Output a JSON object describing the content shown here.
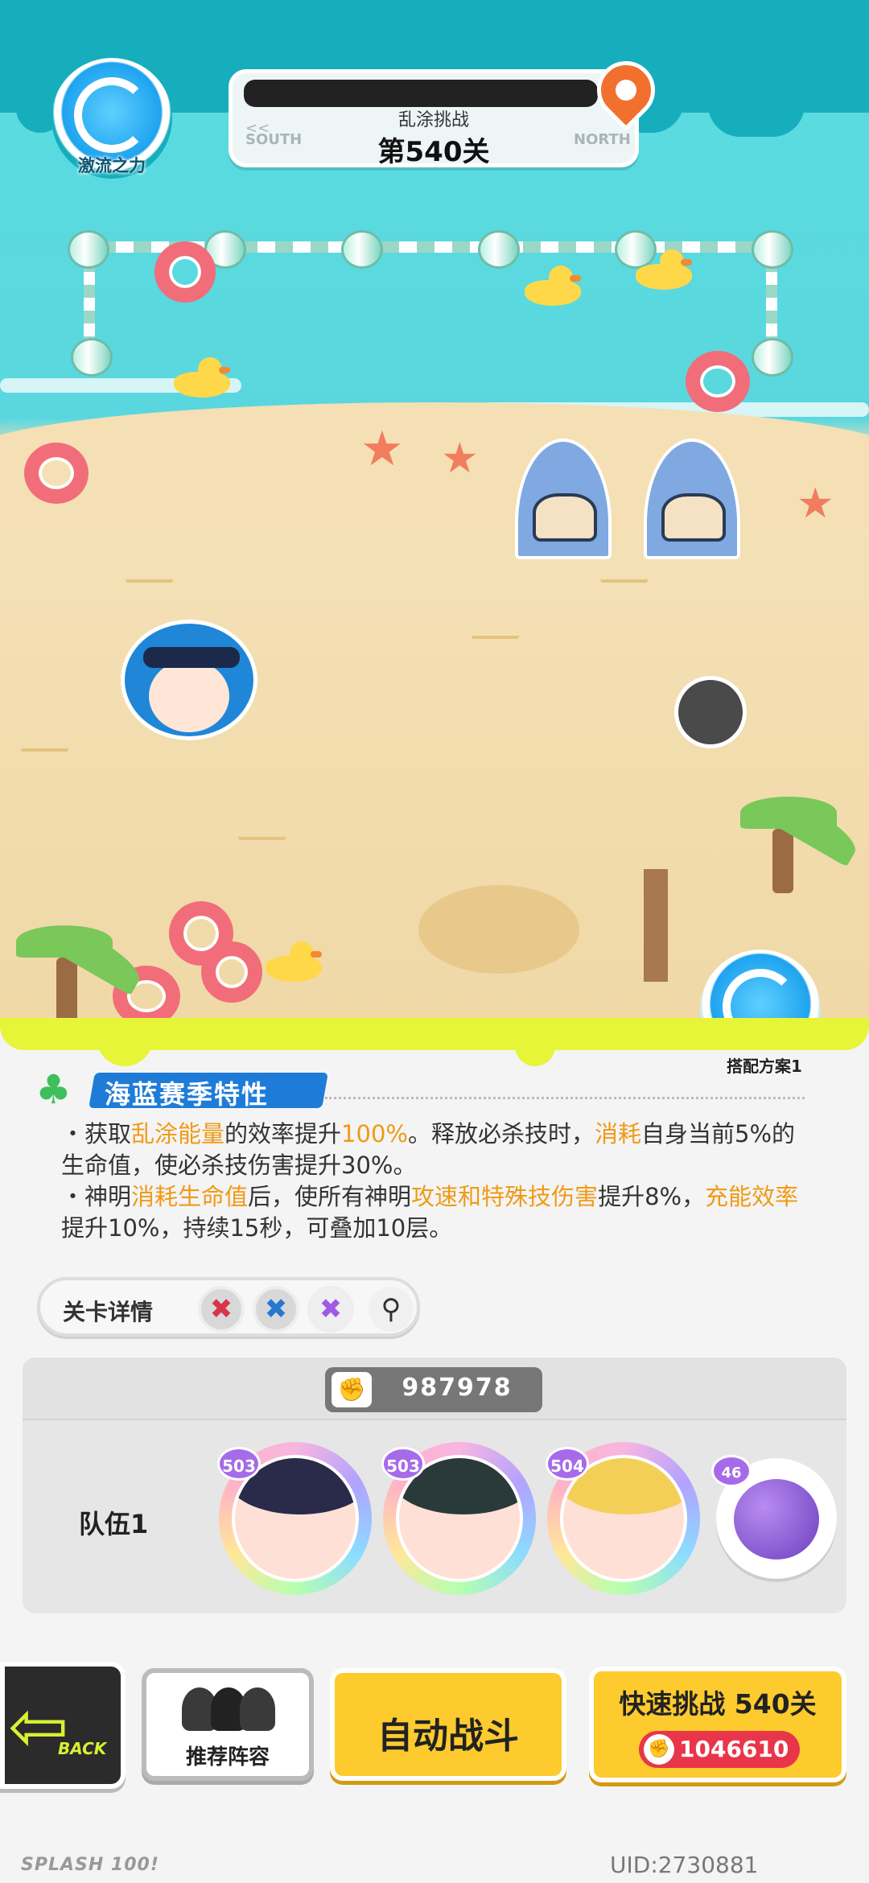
{
  "hud": {
    "element_badge_label": "激流之力",
    "level_subtitle": "乱涂挑战",
    "level_title": "第540关",
    "dir_left": "SOUTH",
    "dir_right": "NORTH",
    "arrows": "<<"
  },
  "panel": {
    "mix_label": "搭配方案1",
    "season_title": "海蓝赛季特性",
    "traits": [
      {
        "bullet": "・获取",
        "hl1": "乱涂能量",
        "mid1": "的效率提升",
        "hl2": "100%",
        "mid2": "。释放必杀技时，",
        "hl3": "消耗",
        "end": "自身当前5%的生命值，使必杀技伤害提升30%。"
      },
      {
        "bullet": "・神明",
        "hl1": "消耗生命值",
        "mid1": "后，使所有神明",
        "hl2": "攻速和特殊技伤害",
        "mid2": "提升8%，",
        "hl3": "充能效率",
        "end": "提升10%，持续15秒，可叠加10层。"
      }
    ],
    "stage_detail_label": "关卡详情",
    "elements": [
      {
        "icon": "red-splat-icon",
        "color": "#d8344a"
      },
      {
        "icon": "blue-splat-icon",
        "color": "#2478d0"
      },
      {
        "icon": "purple-splat-icon",
        "color": "#a05ae6"
      }
    ]
  },
  "team": {
    "power": "987978",
    "label": "队伍1",
    "heroes": [
      {
        "level": "503",
        "hair": "#2a2a4a"
      },
      {
        "level": "503",
        "hair": "#2a3a3a"
      },
      {
        "level": "504",
        "hair": "#f4cf58"
      }
    ],
    "pet_level": "46"
  },
  "buttons": {
    "back": "BACK",
    "recommend": "推荐阵容",
    "auto_battle": "自动战斗",
    "quick_challenge": "快速挑战 540关",
    "quick_cost": "1046610"
  },
  "footer": {
    "brand": "SPLASH 100!",
    "uid": "UID:2730881"
  }
}
